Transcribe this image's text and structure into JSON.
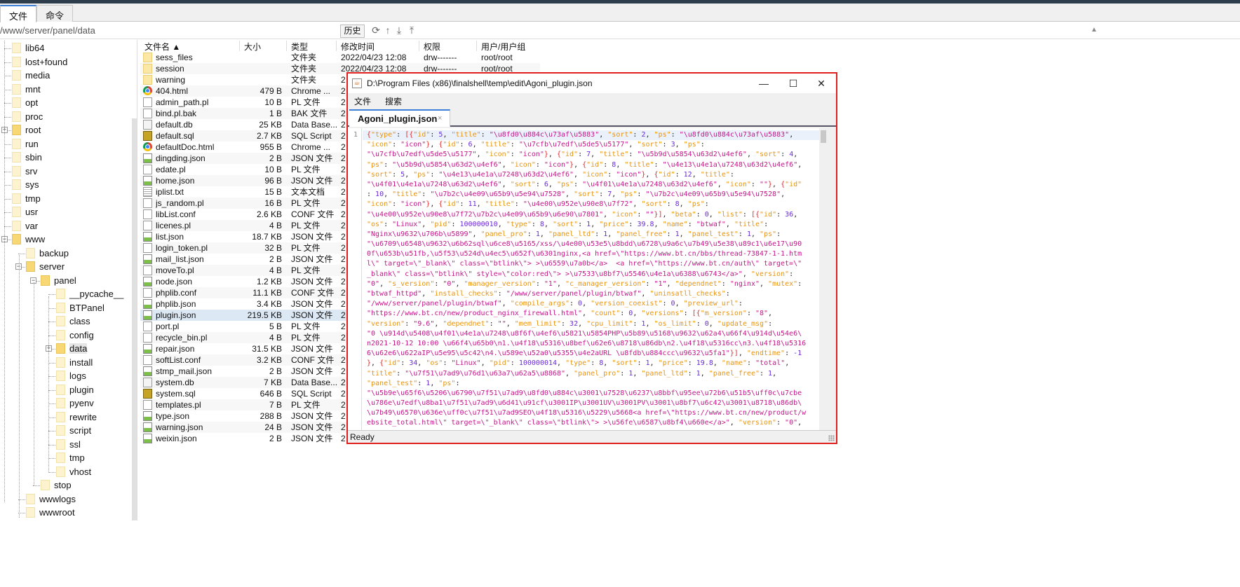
{
  "tabs": [
    {
      "label": "文件",
      "active": true
    },
    {
      "label": "命令",
      "active": false
    }
  ],
  "path": "/www/server/panel/data",
  "history_label": "历史",
  "toolbar_icons": [
    "refresh-icon",
    "up-dir-icon",
    "download-icon",
    "upload-icon"
  ],
  "tree": [
    {
      "label": "lib64",
      "level": 0
    },
    {
      "label": "lost+found",
      "level": 0
    },
    {
      "label": "media",
      "level": 0
    },
    {
      "label": "mnt",
      "level": 0
    },
    {
      "label": "opt",
      "level": 0
    },
    {
      "label": "proc",
      "level": 0
    },
    {
      "label": "root",
      "level": 0,
      "expander": "+"
    },
    {
      "label": "run",
      "level": 0
    },
    {
      "label": "sbin",
      "level": 0
    },
    {
      "label": "srv",
      "level": 0
    },
    {
      "label": "sys",
      "level": 0
    },
    {
      "label": "tmp",
      "level": 0
    },
    {
      "label": "usr",
      "level": 0
    },
    {
      "label": "var",
      "level": 0
    },
    {
      "label": "www",
      "level": 0,
      "expander": "-"
    },
    {
      "label": "backup",
      "level": 1
    },
    {
      "label": "server",
      "level": 1,
      "expander": "-"
    },
    {
      "label": "panel",
      "level": 2,
      "expander": "-"
    },
    {
      "label": "__pycache__",
      "level": 3
    },
    {
      "label": "BTPanel",
      "level": 3
    },
    {
      "label": "class",
      "level": 3
    },
    {
      "label": "config",
      "level": 3
    },
    {
      "label": "data",
      "level": 3,
      "expander": "+",
      "selected": true
    },
    {
      "label": "install",
      "level": 3
    },
    {
      "label": "logs",
      "level": 3
    },
    {
      "label": "plugin",
      "level": 3
    },
    {
      "label": "pyenv",
      "level": 3
    },
    {
      "label": "rewrite",
      "level": 3
    },
    {
      "label": "script",
      "level": 3
    },
    {
      "label": "ssl",
      "level": 3
    },
    {
      "label": "tmp",
      "level": 3
    },
    {
      "label": "vhost",
      "level": 3
    },
    {
      "label": "stop",
      "level": 2
    },
    {
      "label": "wwwlogs",
      "level": 1
    },
    {
      "label": "wwwroot",
      "level": 1
    }
  ],
  "list_headers": [
    "文件名 ▲",
    "大小",
    "类型",
    "修改时间",
    "权限",
    "用户/用户组"
  ],
  "files": [
    {
      "name": "sess_files",
      "size": "",
      "type": "文件夹",
      "mtime": "2022/04/23 12:08",
      "perm": "drw-------",
      "owner": "root/root",
      "icon": "folder"
    },
    {
      "name": "session",
      "size": "",
      "type": "文件夹",
      "mtime": "2022/04/23 12:08",
      "perm": "drw-------",
      "owner": "root/root",
      "icon": "folder"
    },
    {
      "name": "warning",
      "size": "",
      "type": "文件夹",
      "mtime": "2",
      "icon": "folder"
    },
    {
      "name": "404.html",
      "size": "479 B",
      "type": "Chrome ...",
      "mtime": "2",
      "icon": "chrome"
    },
    {
      "name": "admin_path.pl",
      "size": "10 B",
      "type": "PL 文件",
      "mtime": "2",
      "icon": "file"
    },
    {
      "name": "bind.pl.bak",
      "size": "1 B",
      "type": "BAK 文件",
      "mtime": "2",
      "icon": "file"
    },
    {
      "name": "default.db",
      "size": "25 KB",
      "type": "Data Base...",
      "mtime": "2",
      "icon": "db"
    },
    {
      "name": "default.sql",
      "size": "2.7 KB",
      "type": "SQL Script",
      "mtime": "2",
      "icon": "sql"
    },
    {
      "name": "defaultDoc.html",
      "size": "955 B",
      "type": "Chrome ...",
      "mtime": "2",
      "icon": "chrome"
    },
    {
      "name": "dingding.json",
      "size": "2 B",
      "type": "JSON 文件",
      "mtime": "2",
      "icon": "json"
    },
    {
      "name": "edate.pl",
      "size": "10 B",
      "type": "PL 文件",
      "mtime": "2",
      "icon": "file"
    },
    {
      "name": "home.json",
      "size": "96 B",
      "type": "JSON 文件",
      "mtime": "2",
      "icon": "json"
    },
    {
      "name": "iplist.txt",
      "size": "15 B",
      "type": "文本文档",
      "mtime": "2",
      "icon": "txt"
    },
    {
      "name": "js_random.pl",
      "size": "16 B",
      "type": "PL 文件",
      "mtime": "2",
      "icon": "file"
    },
    {
      "name": "libList.conf",
      "size": "2.6 KB",
      "type": "CONF 文件",
      "mtime": "2",
      "icon": "file"
    },
    {
      "name": "licenes.pl",
      "size": "4 B",
      "type": "PL 文件",
      "mtime": "2",
      "icon": "file"
    },
    {
      "name": "list.json",
      "size": "18.7 KB",
      "type": "JSON 文件",
      "mtime": "2",
      "icon": "json"
    },
    {
      "name": "login_token.pl",
      "size": "32 B",
      "type": "PL 文件",
      "mtime": "2",
      "icon": "file"
    },
    {
      "name": "mail_list.json",
      "size": "2 B",
      "type": "JSON 文件",
      "mtime": "2",
      "icon": "json"
    },
    {
      "name": "moveTo.pl",
      "size": "4 B",
      "type": "PL 文件",
      "mtime": "2",
      "icon": "file"
    },
    {
      "name": "node.json",
      "size": "1.2 KB",
      "type": "JSON 文件",
      "mtime": "2",
      "icon": "json"
    },
    {
      "name": "phplib.conf",
      "size": "11.1 KB",
      "type": "CONF 文件",
      "mtime": "2",
      "icon": "file"
    },
    {
      "name": "phplib.json",
      "size": "3.4 KB",
      "type": "JSON 文件",
      "mtime": "2",
      "icon": "json"
    },
    {
      "name": "plugin.json",
      "size": "219.5 KB",
      "type": "JSON 文件",
      "mtime": "2",
      "icon": "json",
      "selected": true
    },
    {
      "name": "port.pl",
      "size": "5 B",
      "type": "PL 文件",
      "mtime": "2",
      "icon": "file"
    },
    {
      "name": "recycle_bin.pl",
      "size": "4 B",
      "type": "PL 文件",
      "mtime": "2",
      "icon": "file"
    },
    {
      "name": "repair.json",
      "size": "31.5 KB",
      "type": "JSON 文件",
      "mtime": "2",
      "icon": "json"
    },
    {
      "name": "softList.conf",
      "size": "3.2 KB",
      "type": "CONF 文件",
      "mtime": "2",
      "icon": "file"
    },
    {
      "name": "stmp_mail.json",
      "size": "2 B",
      "type": "JSON 文件",
      "mtime": "2",
      "icon": "json"
    },
    {
      "name": "system.db",
      "size": "7 KB",
      "type": "Data Base...",
      "mtime": "2",
      "icon": "db"
    },
    {
      "name": "system.sql",
      "size": "646 B",
      "type": "SQL Script",
      "mtime": "2",
      "icon": "sql"
    },
    {
      "name": "templates.pl",
      "size": "7 B",
      "type": "PL 文件",
      "mtime": "2",
      "icon": "file"
    },
    {
      "name": "type.json",
      "size": "288 B",
      "type": "JSON 文件",
      "mtime": "2",
      "icon": "json"
    },
    {
      "name": "warning.json",
      "size": "24 B",
      "type": "JSON 文件",
      "mtime": "2",
      "icon": "json"
    },
    {
      "name": "weixin.json",
      "size": "2 B",
      "type": "JSON 文件",
      "mtime": "2",
      "icon": "json"
    }
  ],
  "editor": {
    "title": "D:\\Program Files (x86)\\finalshell\\temp\\edit\\Agoni_plugin.json",
    "menu": [
      "文件",
      "搜索"
    ],
    "tab_label": "Agoni_plugin.json",
    "tab_close": "×",
    "line_number": "1",
    "status": "Ready",
    "colors": {
      "key": "#e8940e",
      "string": "#c4168a",
      "number": "#6a2bd8",
      "bracket": "#e02a2a",
      "border": "#e0201c"
    },
    "lines": [
      "{\"type\": [{\"id\": 5, \"title\": \"\\u8fd0\\u884c\\u73af\\u5883\", \"sort\": 2, \"ps\": \"\\u8fd0\\u884c\\u73af\\u5883\",",
      "\"icon\": \"icon\"}, {\"id\": 6, \"title\": \"\\u7cfb\\u7edf\\u5de5\\u5177\", \"sort\": 3, \"ps\":",
      "\"\\u7cfb\\u7edf\\u5de5\\u5177\", \"icon\": \"icon\"}, {\"id\": 7, \"title\": \"\\u5b9d\\u5854\\u63d2\\u4ef6\", \"sort\": 4,",
      "\"ps\": \"\\u5b9d\\u5854\\u63d2\\u4ef6\", \"icon\": \"icon\"}, {\"id\": 8, \"title\": \"\\u4e13\\u4e1a\\u7248\\u63d2\\u4ef6\",",
      "\"sort\": 5, \"ps\": \"\\u4e13\\u4e1a\\u7248\\u63d2\\u4ef6\", \"icon\": \"icon\"}, {\"id\": 12, \"title\":",
      "\"\\u4f01\\u4e1a\\u7248\\u63d2\\u4ef6\", \"sort\": 6, \"ps\": \"\\u4f01\\u4e1a\\u7248\\u63d2\\u4ef6\", \"icon\": \"\"}, {\"id\"",
      ": 10, \"title\": \"\\u7b2c\\u4e09\\u65b9\\u5e94\\u7528\", \"sort\": 7, \"ps\": \"\\u7b2c\\u4e09\\u65b9\\u5e94\\u7528\",",
      "\"icon\": \"icon\"}, {\"id\": 11, \"title\": \"\\u4e00\\u952e\\u90e8\\u7f72\", \"sort\": 8, \"ps\":",
      "\"\\u4e00\\u952e\\u90e8\\u7f72\\u7b2c\\u4e09\\u65b9\\u6e90\\u7801\", \"icon\": \"\"}], \"beta\": 0, \"list\": [{\"id\": 36,",
      "\"os\": \"Linux\", \"pid\": 100000010, \"type\": 8, \"sort\": 1, \"price\": 39.8, \"name\": \"btwaf\", \"title\":",
      "\"Nginx\\u9632\\u706b\\u5899\", \"panel_pro\": 1, \"panel_ltd\": 1, \"panel_free\": 1, \"panel_test\": 1, \"ps\":",
      "\"\\u6709\\u6548\\u9632\\u6b62sql\\u6ce8\\u5165/xss/\\u4e00\\u53e5\\u8bdd\\u6728\\u9a6c\\u7b49\\u5e38\\u89c1\\u6e17\\u90",
      "0f\\u653b\\u51fb,\\u5f53\\u524d\\u4ec5\\u652f\\u6301nginx,<a href=\\\"https://www.bt.cn/bbs/thread-73847-1-1.htm",
      "l\\\" target=\\\"_blank\\\" class=\\\"btlink\\\"> >\\u6559\\u7a0b</a>  <a href=\\\"https://www.bt.cn/auth\\\" target=\\\"",
      "_blank\\\" class=\\\"btlink\\\" style=\\\"color:red\\\"> >\\u7533\\u8bf7\\u5546\\u4e1a\\u6388\\u6743</a>\", \"version\":",
      "\"0\", \"s_version\": \"0\", \"manager_version\": \"1\", \"c_manager_version\": \"1\", \"dependnet\": \"nginx\", \"mutex\":",
      "\"btwaf_httpd\", \"install_checks\": \"/www/server/panel/plugin/btwaf\", \"uninsatll_checks\":",
      "\"/www/server/panel/plugin/btwaf\", \"compile_args\": 0, \"version_coexist\": 0, \"preview_url\":",
      "\"https://www.bt.cn/new/product_nginx_firewall.html\", \"count\": 0, \"versions\": [{\"m_version\": \"8\",",
      "\"version\": \"9.6\", \"dependnet\": \"\", \"mem_limit\": 32, \"cpu_limit\": 1, \"os_limit\": 0, \"update_msg\":",
      "\"0 \\u914d\\u5408\\u4f01\\u4e1a\\u7248\\u8f6f\\u4ef6\\u5821\\u5854PHP\\u5b89\\u5168\\u9632\\u62a4\\u66f4\\u914d\\u54e6\\",
      "n2021-10-12 10:00 \\u66f4\\u65b0\\n1.\\u4f18\\u5316\\u8bef\\u62e6\\u8718\\u86db\\n2.\\u4f18\\u5316cc\\n3.\\u4f18\\u5316",
      "6\\u62e6\\u622aIP\\u5e95\\u5c42\\n4.\\u589e\\u52a0\\u5355\\u4e2aURL \\u8fdb\\u884ccc\\u9632\\u5fa1\"}], \"endtime\": -1",
      "}, {\"id\": 34, \"os\": \"Linux\", \"pid\": 100000014, \"type\": 8, \"sort\": 1, \"price\": 19.8, \"name\": \"total\",",
      "\"title\": \"\\u7f51\\u7ad9\\u76d1\\u63a7\\u62a5\\u8868\", \"panel_pro\": 1, \"panel_ltd\": 1, \"panel_free\": 1,",
      "\"panel_test\": 1, \"ps\":",
      "\"\\u5b9e\\u65f6\\u5206\\u6790\\u7f51\\u7ad9\\u8fd0\\u884c\\u3001\\u7528\\u6237\\u8bbf\\u95ee\\u72b6\\u51b5\\uff0c\\u7cbe",
      "\\u786e\\u7edf\\u8ba1\\u7f51\\u7ad9\\u6d41\\u91cf\\u3001IP\\u3001UV\\u3001PV\\u3001\\u8bf7\\u6c42\\u3001\\u8718\\u86db\\",
      "\\u7b49\\u6570\\u636e\\uff0c\\u7f51\\u7ad9SEO\\u4f18\\u5316\\u5229\\u5668<a href=\\\"https://www.bt.cn/new/product/w",
      "ebsite_total.html\\\" target=\\\"_blank\\\" class=\\\"btlink\\\"> >\\u56fe\\u6587\\u8bf4\\u660e</a>\", \"version\": \"0\","
    ]
  }
}
